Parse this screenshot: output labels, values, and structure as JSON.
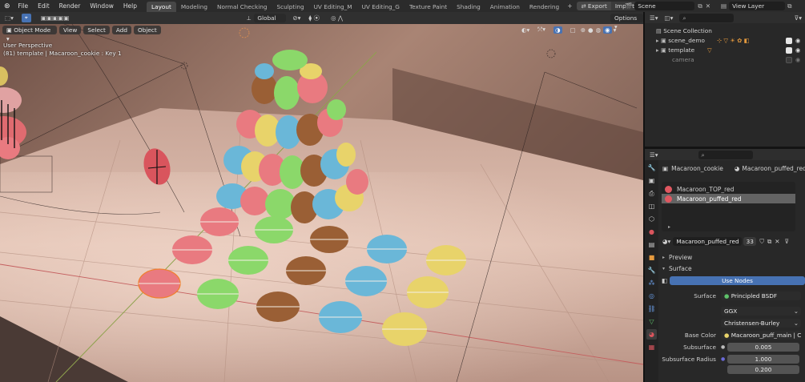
{
  "menu": {
    "items": [
      "File",
      "Edit",
      "Render",
      "Window",
      "Help"
    ]
  },
  "workspaces": {
    "tabs": [
      "Layout",
      "Modeling",
      "Normal Checking",
      "Sculpting",
      "UV Editing_M",
      "UV Editing_G",
      "Texture Paint",
      "Shading",
      "Animation",
      "Rendering"
    ],
    "active": "Layout",
    "export_label": "Export",
    "import_label": "Import"
  },
  "scene": {
    "name": "Scene",
    "view_layer": "View Layer"
  },
  "toolheader": {
    "orientation": "Global",
    "options_label": "Options"
  },
  "viewport": {
    "mode": "Object Mode",
    "menus": [
      "View",
      "Select",
      "Add",
      "Object"
    ],
    "perspective": "User Perspective",
    "info": "(81) template | Macaroon_cookie : Key 1"
  },
  "outliner": {
    "root": "Scene Collection",
    "items": [
      {
        "label": "scene_demo",
        "visible": true
      },
      {
        "label": "template",
        "visible": true
      },
      {
        "label": "camera",
        "visible": false
      }
    ]
  },
  "properties": {
    "object_name": "Macaroon_cookie",
    "material_slot_name": "Macaroon_puffed_red",
    "slots": [
      {
        "label": "Macaroon_TOP_red",
        "selected": false
      },
      {
        "label": "Macaroon_puffed_red",
        "selected": true
      }
    ],
    "material_name": "Macaroon_puffed_red",
    "users_count": "33",
    "panels": {
      "preview": "Preview",
      "surface": "Surface"
    },
    "use_nodes_label": "Use Nodes",
    "surface_label": "Surface",
    "surface_value": "Principled BSDF",
    "distribution": "GGX",
    "subsurface_method": "Christensen-Burley",
    "base_color_label": "Base Color",
    "base_color_value": "Macaroon_puff_main | Color",
    "subsurface_label": "Subsurface",
    "subsurface_value": "0.005",
    "subsurface_radius_label": "Subsurface Radius",
    "subsurface_radius_values": [
      "1.000",
      "0.200"
    ]
  },
  "colors": {
    "accent_blue": "#4772b3",
    "pink": "#e97a80",
    "green": "#8bd86a",
    "blue": "#6ab7d8",
    "yellow": "#e8d36a",
    "brown": "#9a5f35"
  }
}
